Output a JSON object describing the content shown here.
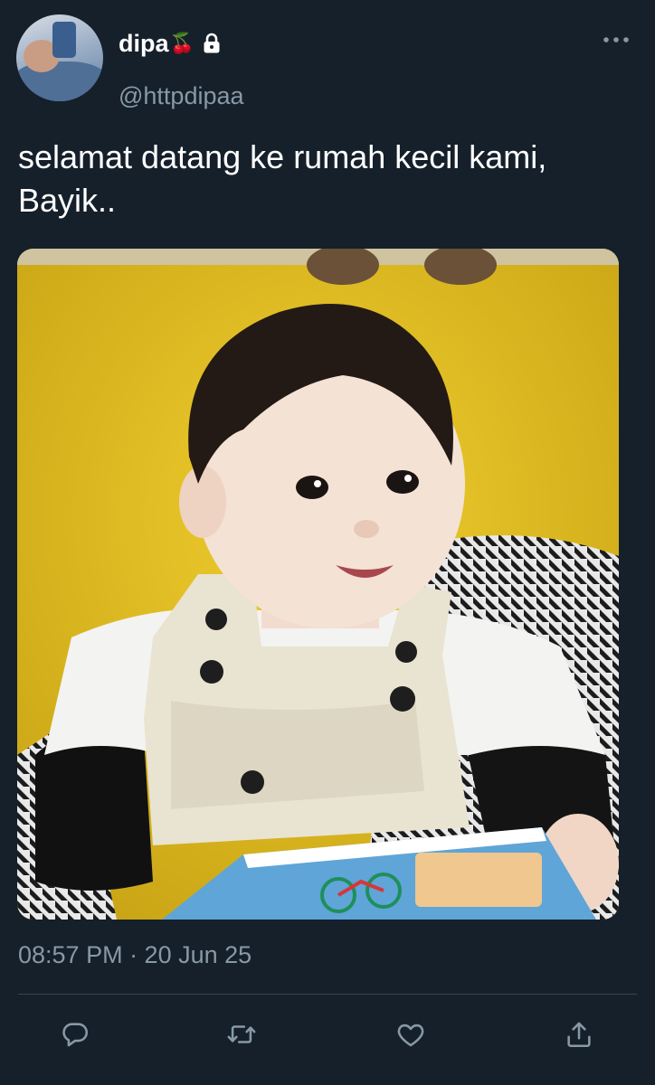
{
  "tweet": {
    "author": {
      "display_name": "dipa",
      "name_emoji": "🍒",
      "handle": "@httpdipaa",
      "protected": true
    },
    "text": "selamat datang ke rumah kecil kami, Bayik..",
    "timestamp": "08:57 PM · 20 Jun 25"
  },
  "icons": {
    "more": "more-horizontal-icon",
    "lock": "lock-icon",
    "reply": "reply-icon",
    "retweet": "retweet-icon",
    "like": "heart-icon",
    "share": "share-icon"
  },
  "colors": {
    "background": "#15202b",
    "text_primary": "#ffffff",
    "text_secondary": "#8899a6",
    "divider": "#38444d"
  }
}
